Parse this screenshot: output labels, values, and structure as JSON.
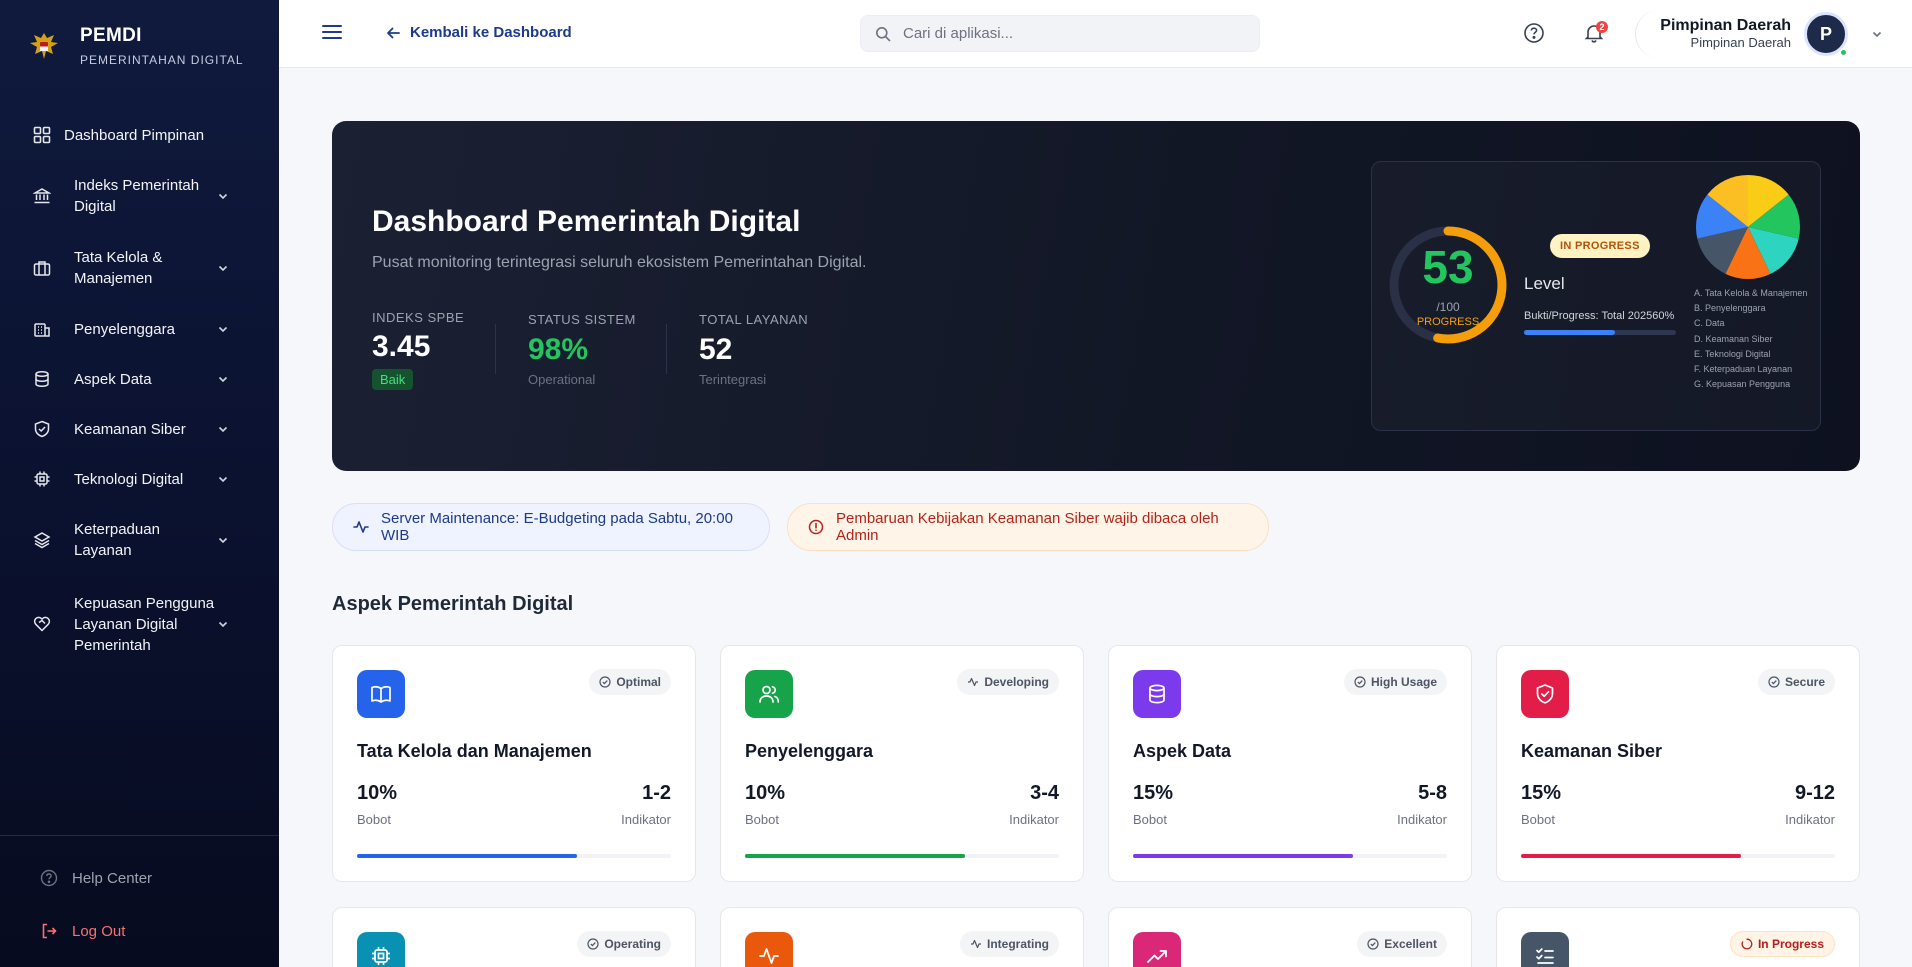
{
  "brand": {
    "title": "PEMDI",
    "subtitle": "PEMERINTAHAN DIGITAL"
  },
  "sidebar": {
    "items": [
      {
        "label": "Dashboard Pimpinan",
        "icon": "grid-icon",
        "expandable": false
      },
      {
        "label": "Indeks Pemerintah Digital",
        "icon": "bank-icon",
        "expandable": true
      },
      {
        "label": "Tata Kelola & Manajemen",
        "icon": "briefcase-icon",
        "expandable": true
      },
      {
        "label": "Penyelenggara",
        "icon": "building-icon",
        "expandable": true
      },
      {
        "label": "Aspek Data",
        "icon": "database-icon",
        "expandable": true
      },
      {
        "label": "Keamanan Siber",
        "icon": "shield-check-icon",
        "expandable": true
      },
      {
        "label": "Teknologi Digital",
        "icon": "chip-icon",
        "expandable": true
      },
      {
        "label": "Keterpaduan Layanan",
        "icon": "layers-icon",
        "expandable": true
      },
      {
        "label": "Kepuasan Pengguna Layanan Digital Pemerintah",
        "icon": "heart-handshake-icon",
        "expandable": true
      }
    ],
    "help": "Help Center",
    "logout": "Log Out"
  },
  "header": {
    "back_label": "Kembali ke Dashboard",
    "search_placeholder": "Cari di aplikasi...",
    "notif_count": "2",
    "user_name": "Pimpinan Daerah",
    "user_role": "Pimpinan Daerah",
    "avatar_initial": "P"
  },
  "hero": {
    "title": "Dashboard Pemerintah Digital",
    "subtitle": "Pusat monitoring terintegrasi seluruh ekosistem Pemerintahan Digital.",
    "stats": [
      {
        "label": "INDEKS SPBE",
        "value": "3.45",
        "note": "Baik"
      },
      {
        "label": "STATUS SISTEM",
        "value": "98%",
        "note": "Operational"
      },
      {
        "label": "TOTAL LAYANAN",
        "value": "52",
        "note": "Terintegrasi"
      }
    ],
    "score": {
      "value": "53",
      "max": "/100",
      "label": "PROGRESS",
      "fraction": 0.53
    },
    "status_badge": "IN PROGRESS",
    "level_label": "Level",
    "bukti_label": "Bukti/Progress: Total 202560%",
    "bukti_fraction": 0.6,
    "pie_legend": [
      "A. Tata Kelola & Manajemen",
      "B. Penyelenggara",
      "C. Data",
      "D. Keamanan Siber",
      "E. Teknologi Digital",
      "F. Keterpaduan Layanan",
      "G. Kepuasan Pengguna"
    ],
    "pie_colors": [
      "#facc15",
      "#22c55e",
      "#2dd4bf",
      "#f97316",
      "#475569",
      "#3b82f6",
      "#fbbf24"
    ]
  },
  "alerts": [
    {
      "text": "Server Maintenance: E-Budgeting pada Sabtu, 20:00 WIB",
      "color": "#1e3a8a"
    },
    {
      "text": "Pembaruan Kebijakan Keamanan Siber wajib dibaca oleh Admin",
      "color": "#b42318"
    }
  ],
  "section_title": "Aspek Pemerintah Digital",
  "cards": [
    {
      "title": "Tata Kelola dan Manajemen",
      "badge": "Optimal",
      "bobot": "10%",
      "bobot_label": "Bobot",
      "indikator": "1-2",
      "indikator_label": "Indikator",
      "color": "#2563eb",
      "progress": 0.7,
      "icon": "book-open-icon",
      "badge_icon": "check-circle-icon"
    },
    {
      "title": "Penyelenggara",
      "badge": "Developing",
      "bobot": "10%",
      "bobot_label": "Bobot",
      "indikator": "3-4",
      "indikator_label": "Indikator",
      "color": "#16a34a",
      "progress": 0.7,
      "icon": "users-icon",
      "badge_icon": "activity-icon"
    },
    {
      "title": "Aspek Data",
      "badge": "High Usage",
      "bobot": "15%",
      "bobot_label": "Bobot",
      "indikator": "5-8",
      "indikator_label": "Indikator",
      "color": "#7c3aed",
      "progress": 0.7,
      "icon": "database-icon",
      "badge_icon": "check-circle-icon"
    },
    {
      "title": "Keamanan Siber",
      "badge": "Secure",
      "bobot": "15%",
      "bobot_label": "Bobot",
      "indikator": "9-12",
      "indikator_label": "Indikator",
      "color": "#e11d48",
      "progress": 0.7,
      "icon": "shield-check-icon",
      "badge_icon": "check-circle-icon"
    },
    {
      "badge": "Operating",
      "color": "#0891b2",
      "icon": "chip-icon",
      "badge_icon": "check-circle-icon"
    },
    {
      "badge": "Integrating",
      "color": "#ea580c",
      "icon": "activity-icon",
      "badge_icon": "activity-icon"
    },
    {
      "badge": "Excellent",
      "color": "#db2777",
      "icon": "trending-up-icon",
      "badge_icon": "check-circle-icon"
    },
    {
      "badge": "In Progress",
      "color": "#475569",
      "icon": "list-checks-icon",
      "badge_icon": "loader-icon"
    }
  ]
}
